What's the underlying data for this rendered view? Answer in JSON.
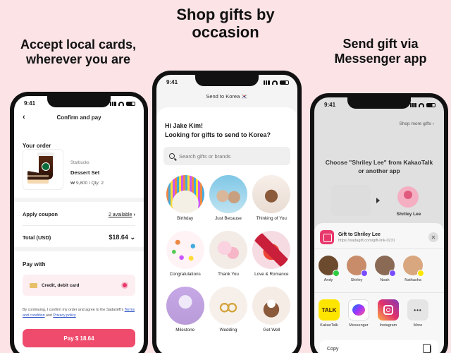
{
  "captions": {
    "left": "Accept local cards, wherever you are",
    "middle": "Shop gifts by occasion",
    "right": "Send gift via Messenger app"
  },
  "status_time": "9:41",
  "checkout": {
    "back_icon": "back-chevron-icon",
    "title": "Confirm and pay",
    "your_order": "Your order",
    "brand": "Starbucks",
    "product_name": "Dessert Set",
    "price_qty": "₩ 9,800 / Qty: 2",
    "apply_coupon": "Apply coupon",
    "coupon_available": "2 available",
    "total_label": "Total (USD)",
    "total_value": "$18.64",
    "pay_with": "Pay with",
    "payment_method": "Credit, debit card",
    "terms_prefix": "By continuing, I confirm my order and agree to the SadaGift's",
    "terms_link": "Terms and condition",
    "and": "and",
    "privacy_link": "Privacy policy",
    "pay_button": "Pay $ 18.64",
    "accent_color": "#ef4b6c"
  },
  "shop": {
    "header": "Send to Korea 🇰🇷",
    "greeting": "Hi Jake Kim!",
    "question": "Looking for gifts to send to Korea?",
    "search_placeholder": "Search gifts or brands",
    "occasions": [
      {
        "label": "Birthday"
      },
      {
        "label": "Just Because"
      },
      {
        "label": "Thinking of You"
      },
      {
        "label": "Congratulations"
      },
      {
        "label": "Thank You"
      },
      {
        "label": "Love & Romance"
      },
      {
        "label": "Milestone"
      },
      {
        "label": "Wedding"
      },
      {
        "label": "Get Well"
      }
    ]
  },
  "share": {
    "shop_more": "Shop more gifts",
    "choose_line1": "Choose \"Shriley Lee\" from KakaoTalk",
    "choose_line2": "or another app",
    "recipient": "Shriley Lee",
    "sheet_title": "Gift to Shriley Lee",
    "sheet_url": "https://sadagift.com/gift-link-0231",
    "people": [
      {
        "name": "Andy",
        "color": "#6b4a2e",
        "badge": "#2ecc40"
      },
      {
        "name": "Shirley",
        "color": "#c88c6a",
        "badge": "#7a4cff"
      },
      {
        "name": "Noah",
        "color": "#8a6a55",
        "badge": "#7a4cff"
      },
      {
        "name": "Nathasha",
        "color": "#d9a77f",
        "badge": "#fee500"
      }
    ],
    "apps": [
      {
        "label": "KakaoTalk",
        "icon": "kakaotalk-icon",
        "text": "TALK"
      },
      {
        "label": "Messenger",
        "icon": "messenger-icon"
      },
      {
        "label": "Instagram",
        "icon": "instagram-icon"
      },
      {
        "label": "More",
        "icon": "more-icon",
        "text": "•••"
      }
    ],
    "copy": "Copy"
  }
}
